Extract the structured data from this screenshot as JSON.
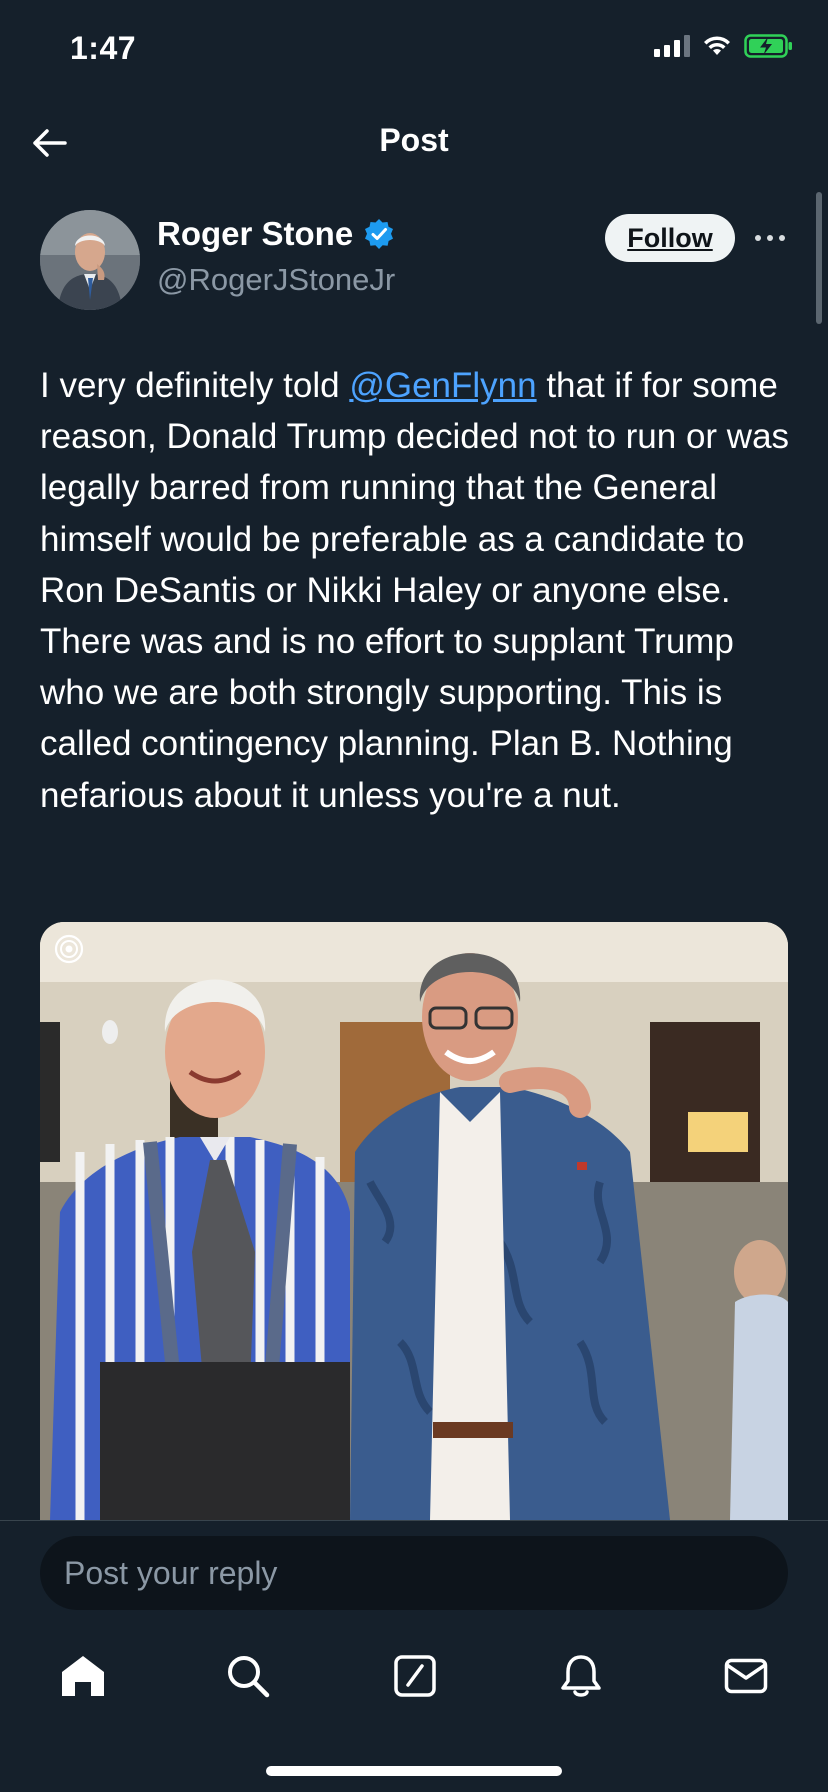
{
  "status_bar": {
    "time": "1:47",
    "icons": [
      "signal-icon",
      "wifi-icon",
      "battery-charging-icon"
    ]
  },
  "header": {
    "title": "Post",
    "back_icon": "arrow-left-icon"
  },
  "post": {
    "author": {
      "name": "Roger Stone",
      "handle": "@RogerJStoneJr",
      "verified": true
    },
    "follow_label": "Follow",
    "more_icon": "more-horizontal-icon",
    "text_before_mention": "I very definitely told ",
    "mention": "@GenFlynn",
    "text_after_mention": " that if for some reason, Donald Trump decided not to run or was legally barred from running that the General himself would be preferable as a candidate to Ron DeSantis or Nikki Haley or anyone else. There was and is no effort to supplant Trump who we are both strongly supporting. This is called contingency planning. Plan B. Nothing nefarious about it unless you're a nut."
  },
  "reply": {
    "placeholder": "Post your reply"
  },
  "bottom_nav": {
    "items": [
      "home-icon",
      "search-icon",
      "compose-icon",
      "notifications-bell-icon",
      "messages-envelope-icon"
    ]
  },
  "colors": {
    "background": "#15202b",
    "link": "#4da3ff",
    "verified": "#1d9bf0",
    "muted_text": "#8b98a5"
  }
}
